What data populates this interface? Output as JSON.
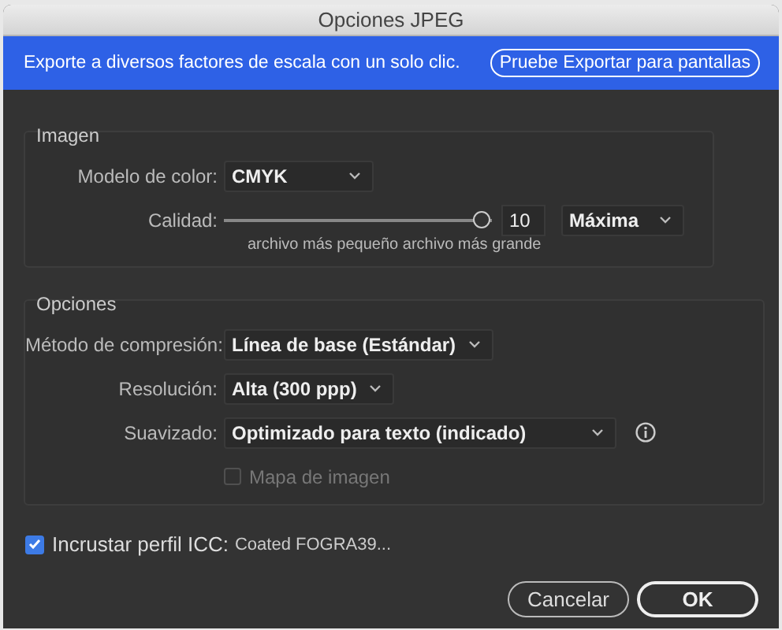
{
  "window": {
    "title": "Opciones JPEG"
  },
  "banner": {
    "message": "Exporte a diversos factores de escala con un solo clic.",
    "button": "Pruebe Exportar para pantallas"
  },
  "sections": [
    {
      "title": "Imagen",
      "rows": [
        {
          "kind": "dropdown",
          "label": "Modelo de color:",
          "value": "CMYK"
        },
        {
          "kind": "slider",
          "label": "Calidad:",
          "level": 1.0,
          "value": "10",
          "preset": "Máxima",
          "hint": "archivo más pequeño archivo más grande"
        }
      ]
    },
    {
      "title": "Opciones",
      "rows": [
        {
          "kind": "dropdown",
          "label": "Método de compresión:",
          "value": "Línea de base (Estándar)"
        },
        {
          "kind": "dropdown",
          "label": "Resolución:",
          "value": "Alta (300 ppp)"
        },
        {
          "kind": "dropdown",
          "label": "Suavizado:",
          "value": "Optimizado para texto (indicado)",
          "info": true
        },
        {
          "kind": "checkbox",
          "label": "Mapa de imagen",
          "checked": false,
          "disabled": true
        }
      ]
    }
  ],
  "icc": {
    "label": "Incrustar perfil ICC:",
    "profile": "Coated FOGRA39...",
    "checked": true
  },
  "buttons": [
    {
      "label": "Cancelar",
      "default": false
    },
    {
      "label": "OK",
      "default": true
    }
  ]
}
